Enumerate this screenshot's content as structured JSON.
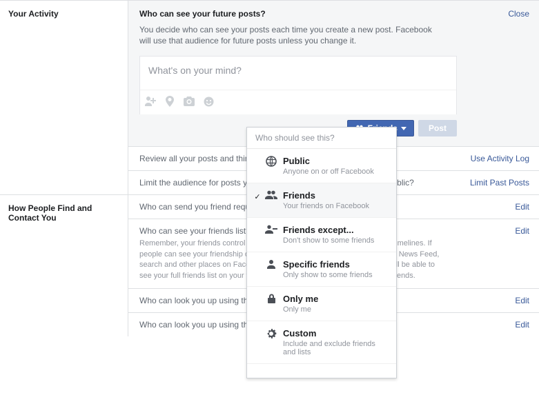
{
  "activity": {
    "heading": "Your Activity",
    "title": "Who can see your future posts?",
    "close": "Close",
    "description": "You decide who can see your posts each time you create a new post. Facebook will use that audience for future posts unless you change it.",
    "composer_placeholder": "What's on your mind?",
    "audience_button": "Friends",
    "post_button": "Post",
    "rows": [
      {
        "label": "Review all your posts and things you're tagged in",
        "action": "Use Activity Log"
      },
      {
        "label": "Limit the audience for posts you've shared with friends of friends or Public?",
        "action": "Limit Past Posts"
      }
    ]
  },
  "contact": {
    "heading": "How People Find and Contact You",
    "rows": [
      {
        "label": "Who can send you friend requests?",
        "action": "Edit"
      },
      {
        "label": "Who can see your friends list?",
        "action": "Edit",
        "remember": "Remember, your friends control who can see their friendships on their own Timelines. If people can see your friendship on another timeline, they'll be able to see it in News Feed, search and other places on Facebook. If you set this to Only me, only you will be able to see your full friends list on your timeline. Other people will see only mutual friends."
      },
      {
        "label": "Who can look you up using the email address you provided?",
        "action": "Edit"
      },
      {
        "label": "Who can look you up using the phone number you provided?",
        "action": "Edit"
      }
    ]
  },
  "dropdown": {
    "header": "Who should see this?",
    "items": [
      {
        "icon": "globe",
        "title": "Public",
        "sub": "Anyone on or off Facebook",
        "selected": false
      },
      {
        "icon": "friends",
        "title": "Friends",
        "sub": "Your friends on Facebook",
        "selected": true
      },
      {
        "icon": "friends-except",
        "title": "Friends except...",
        "sub": "Don't show to some friends",
        "selected": false
      },
      {
        "icon": "person",
        "title": "Specific friends",
        "sub": "Only show to some friends",
        "selected": false
      },
      {
        "icon": "lock",
        "title": "Only me",
        "sub": "Only me",
        "selected": false
      },
      {
        "icon": "gear",
        "title": "Custom",
        "sub": "Include and exclude friends and lists",
        "selected": false
      }
    ]
  }
}
